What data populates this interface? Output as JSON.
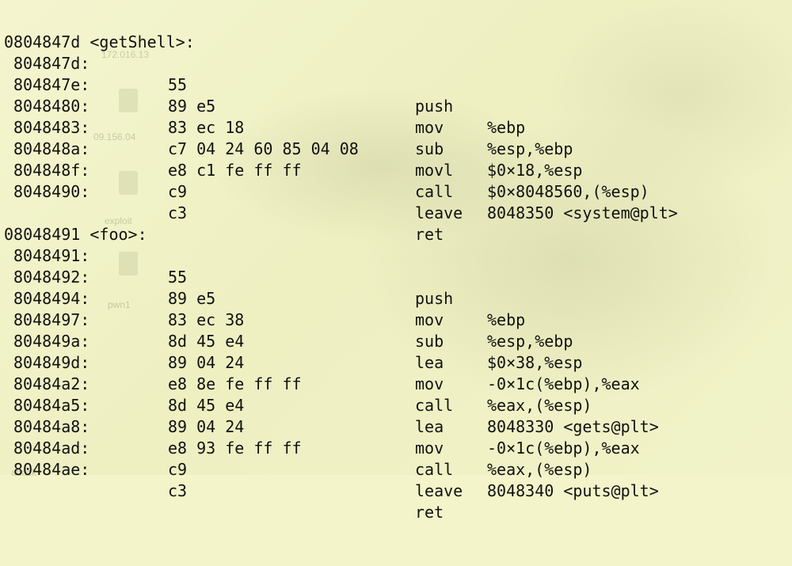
{
  "functions": [
    {
      "header": "0804847d <getShell>:",
      "instructions": [
        {
          "addr": "804847d:",
          "bytes": "55",
          "mnemonic": "push",
          "operands": "%ebp"
        },
        {
          "addr": "804847e:",
          "bytes": "89 e5",
          "mnemonic": "mov",
          "operands": "%esp,%ebp"
        },
        {
          "addr": "8048480:",
          "bytes": "83 ec 18",
          "mnemonic": "sub",
          "operands": "$0×18,%esp"
        },
        {
          "addr": "8048483:",
          "bytes": "c7 04 24 60 85 04 08",
          "mnemonic": "movl",
          "operands": "$0×8048560,(%esp)"
        },
        {
          "addr": "804848a:",
          "bytes": "e8 c1 fe ff ff",
          "mnemonic": "call",
          "operands": "8048350 <system@plt>"
        },
        {
          "addr": "804848f:",
          "bytes": "c9",
          "mnemonic": "leave",
          "operands": ""
        },
        {
          "addr": "8048490:",
          "bytes": "c3",
          "mnemonic": "ret",
          "operands": ""
        }
      ]
    },
    {
      "header": "08048491 <foo>:",
      "instructions": [
        {
          "addr": "8048491:",
          "bytes": "55",
          "mnemonic": "push",
          "operands": "%ebp"
        },
        {
          "addr": "8048492:",
          "bytes": "89 e5",
          "mnemonic": "mov",
          "operands": "%esp,%ebp"
        },
        {
          "addr": "8048494:",
          "bytes": "83 ec 38",
          "mnemonic": "sub",
          "operands": "$0×38,%esp"
        },
        {
          "addr": "8048497:",
          "bytes": "8d 45 e4",
          "mnemonic": "lea",
          "operands": "-0×1c(%ebp),%eax"
        },
        {
          "addr": "804849a:",
          "bytes": "89 04 24",
          "mnemonic": "mov",
          "operands": "%eax,(%esp)"
        },
        {
          "addr": "804849d:",
          "bytes": "e8 8e fe ff ff",
          "mnemonic": "call",
          "operands": "8048330 <gets@plt>"
        },
        {
          "addr": "80484a2:",
          "bytes": "8d 45 e4",
          "mnemonic": "lea",
          "operands": "-0×1c(%ebp),%eax"
        },
        {
          "addr": "80484a5:",
          "bytes": "89 04 24",
          "mnemonic": "mov",
          "operands": "%eax,(%esp)"
        },
        {
          "addr": "80484a8:",
          "bytes": "e8 93 fe ff ff",
          "mnemonic": "call",
          "operands": "8048340 <puts@plt>"
        },
        {
          "addr": "80484ad:",
          "bytes": "c9",
          "mnemonic": "leave",
          "operands": ""
        },
        {
          "addr": "80484ae:",
          "bytes": "c3",
          "mnemonic": "ret",
          "operands": ""
        }
      ]
    }
  ],
  "colors": {
    "background": "#f3f4c9",
    "text": "#111111"
  }
}
